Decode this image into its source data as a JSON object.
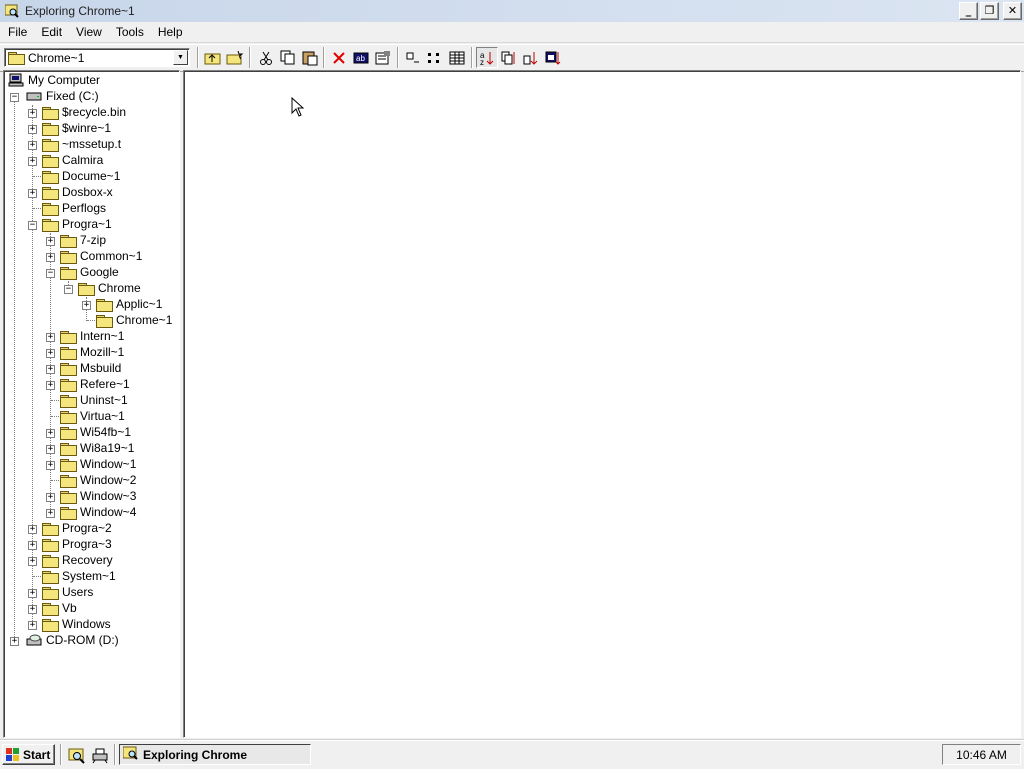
{
  "window": {
    "title": "Exploring Chrome~1"
  },
  "menu": [
    "File",
    "Edit",
    "View",
    "Tools",
    "Help"
  ],
  "toolbar": {
    "location_value": "Chrome~1",
    "buttons": [
      "up-one-level",
      "map-network-drive",
      "cut",
      "copy",
      "paste",
      "delete",
      "rename",
      "properties",
      "large-icons",
      "small-icons",
      "list",
      "details",
      "sort-name",
      "sort-type",
      "sort-size",
      "sort-date"
    ]
  },
  "tree": {
    "root": "My Computer",
    "drive_c": "Fixed (C:)",
    "c_children": [
      "$recycle.bin",
      "$winre~1",
      "~mssetup.t",
      "Calmira",
      "Docume~1",
      "Dosbox-x",
      "Perflogs",
      "Progra~1"
    ],
    "progra1_children": [
      "7-zip",
      "Common~1",
      "Google"
    ],
    "google_children": [
      "Chrome"
    ],
    "chrome_children": [
      "Applic~1",
      "Chrome~1"
    ],
    "progra1_rest": [
      "Intern~1",
      "Mozill~1",
      "Msbuild",
      "Refere~1",
      "Uninst~1",
      "Virtua~1",
      "Wi54fb~1",
      "Wi8a19~1",
      "Window~1",
      "Window~2",
      "Window~3",
      "Window~4"
    ],
    "c_rest": [
      "Progra~2",
      "Progra~3",
      "Recovery",
      "System~1",
      "Users",
      "Vb",
      "Windows"
    ],
    "drive_d": "CD-ROM (D:)"
  },
  "taskbar": {
    "start_label": "Start",
    "task_label": "Exploring Chrome",
    "clock": "10:46 AM"
  }
}
